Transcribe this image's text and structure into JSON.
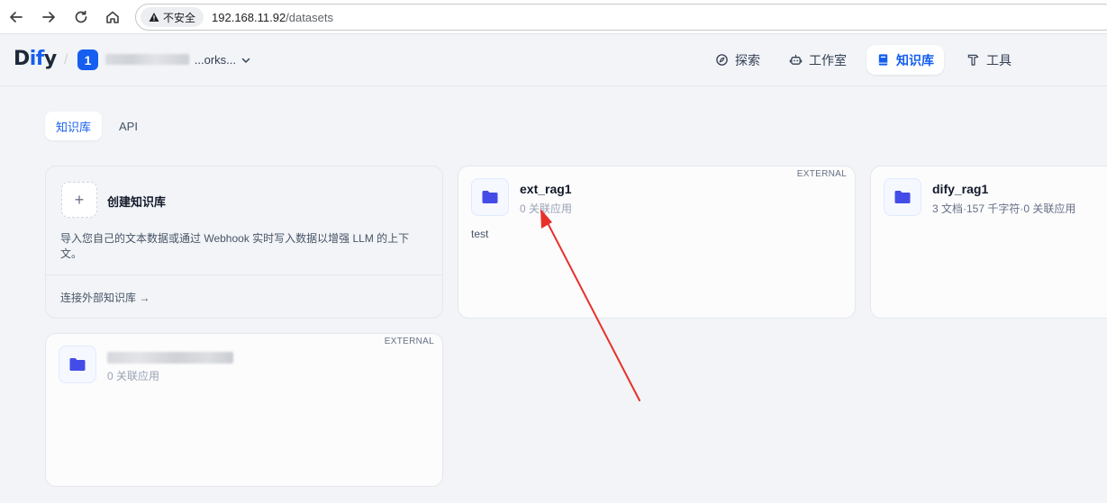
{
  "browser": {
    "insecure_label": "不安全",
    "url_host": "192.168.11.92",
    "url_path": "/datasets"
  },
  "header": {
    "logo_prefix": "D",
    "logo_accent": "if",
    "logo_suffix": "y",
    "workspace_badge": "1",
    "workspace_suffix": "...orks...",
    "nav": [
      {
        "label": "探索",
        "icon": "compass-icon"
      },
      {
        "label": "工作室",
        "icon": "robot-icon"
      },
      {
        "label": "知识库",
        "icon": "book-icon",
        "active": true
      },
      {
        "label": "工具",
        "icon": "hammer-icon"
      }
    ]
  },
  "subtabs": [
    {
      "label": "知识库",
      "active": true
    },
    {
      "label": "API",
      "active": false
    }
  ],
  "create_card": {
    "title": "创建知识库",
    "description": "导入您自己的文本数据或通过 Webhook 实时写入数据以增强 LLM 的上下文。",
    "link": "连接外部知识库",
    "link_arrow": "→",
    "plus": "+"
  },
  "datasets": [
    {
      "name": "ext_rag1",
      "meta": "0 关联应用",
      "tag": "EXTERNAL",
      "description": "test"
    },
    {
      "name": "dify_rag1",
      "meta": "3 文档·157 千字符·0 关联应用",
      "tag": "",
      "description": ""
    },
    {
      "name": "",
      "meta": "0 关联应用",
      "tag": "EXTERNAL",
      "description": ""
    }
  ],
  "colors": {
    "accent": "#155eef",
    "folder": "#444ce7",
    "annotation_arrow": "#e8302a"
  }
}
